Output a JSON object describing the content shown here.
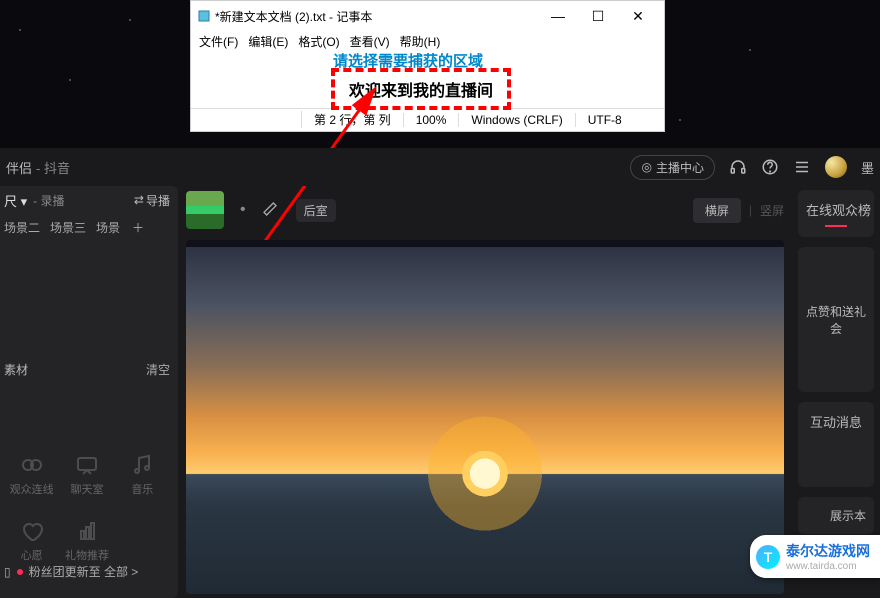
{
  "notepad": {
    "title": "*新建文本文档 (2).txt - 记事本",
    "menu": {
      "file": "文件(F)",
      "edit": "编辑(E)",
      "format": "格式(O)",
      "view": "查看(V)",
      "help": "帮助(H)"
    },
    "select_hint": "请选择需要捕获的区域",
    "content": "欢迎来到我的直播间",
    "status": {
      "pos": "第 2 行，第    列",
      "zoom": "100%",
      "eol": "Windows (CRLF)",
      "enc": "UTF-8"
    }
  },
  "appbar": {
    "product_suffix": "伴侣",
    "brand_suffix": "- 抖音",
    "broadcast_center": "主播中心",
    "user_suffix": "墨"
  },
  "sidebar": {
    "mode_suffix": "尺",
    "type_suffix": "- 录播",
    "swap": "导播",
    "scenes": [
      "场景二",
      "场景三",
      "场景"
    ],
    "section": "素材",
    "clear": "清空",
    "icons": {
      "conn": "观众连线",
      "chat": "聊天室",
      "music": "音乐",
      "heart": "心愿",
      "gift": "礼物推荐"
    },
    "footer": "粉丝团更新至 全部 >"
  },
  "main": {
    "after_room": "后室",
    "orient_h": "横屏",
    "orient_v": "竖屏"
  },
  "rsb": {
    "audience": "在线观众榜",
    "gifts": "点赞和送礼会",
    "interact": "互动消息",
    "show": "展示本"
  },
  "watermark": {
    "name": "泰尔达游戏网",
    "url": "www.tairda.com"
  }
}
